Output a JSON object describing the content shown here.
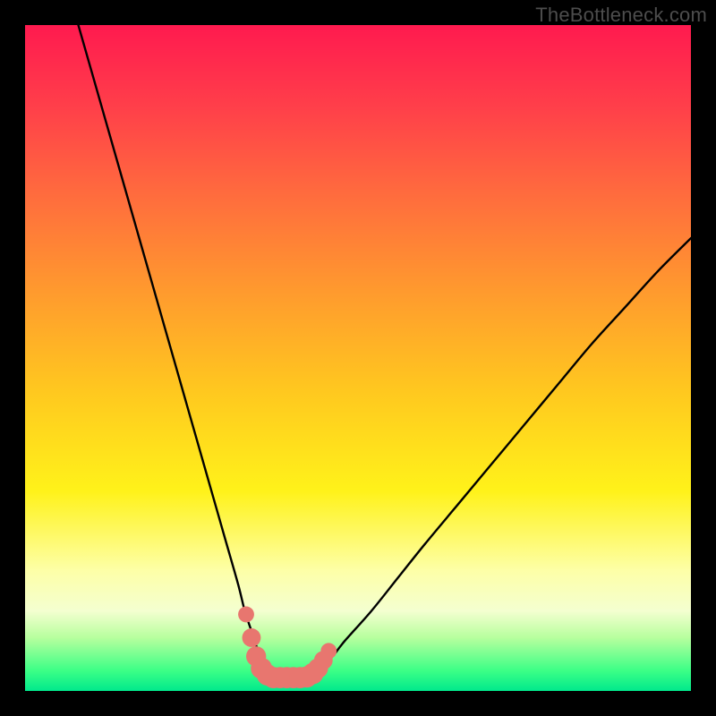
{
  "watermark": "TheBottleneck.com",
  "colors": {
    "frame": "#000000",
    "curve_stroke": "#000000",
    "dot_fill": "#e8766f",
    "gradient_stops": [
      "#ff1a4f",
      "#ff3e4a",
      "#ff6a3e",
      "#ff9a2e",
      "#ffc81f",
      "#fff21a",
      "#fdffa8",
      "#f4ffd0",
      "#b7ff9e",
      "#3bff86",
      "#00e98c"
    ]
  },
  "chart_data": {
    "type": "line",
    "title": "",
    "xlabel": "",
    "ylabel": "",
    "xlim": [
      0,
      100
    ],
    "ylim": [
      0,
      100
    ],
    "series": [
      {
        "name": "bottleneck-curve",
        "x": [
          8,
          10,
          12,
          14,
          16,
          18,
          20,
          22,
          24,
          26,
          28,
          30,
          32,
          33,
          34,
          35,
          36,
          37,
          38,
          39,
          40,
          41,
          42,
          43,
          44,
          46,
          48,
          52,
          56,
          60,
          65,
          70,
          75,
          80,
          85,
          90,
          95,
          100
        ],
        "y": [
          100,
          93,
          86,
          79,
          72,
          65,
          58,
          51,
          44,
          37,
          30,
          23,
          16,
          12,
          9,
          6,
          4,
          3,
          2.2,
          2,
          2,
          2,
          2.2,
          2.6,
          3.4,
          5,
          7.5,
          12,
          17,
          22,
          28,
          34,
          40,
          46,
          52,
          57.5,
          63,
          68
        ]
      }
    ],
    "highlight_points": {
      "name": "bottom-cluster",
      "points": [
        {
          "x": 33.2,
          "y": 11.5,
          "r": 1.2
        },
        {
          "x": 34.0,
          "y": 8.0,
          "r": 1.4
        },
        {
          "x": 34.7,
          "y": 5.2,
          "r": 1.5
        },
        {
          "x": 35.5,
          "y": 3.4,
          "r": 1.6
        },
        {
          "x": 36.4,
          "y": 2.4,
          "r": 1.6
        },
        {
          "x": 37.3,
          "y": 2.0,
          "r": 1.6
        },
        {
          "x": 38.3,
          "y": 2.0,
          "r": 1.6
        },
        {
          "x": 39.3,
          "y": 2.0,
          "r": 1.6
        },
        {
          "x": 40.3,
          "y": 2.0,
          "r": 1.6
        },
        {
          "x": 41.3,
          "y": 2.0,
          "r": 1.6
        },
        {
          "x": 42.3,
          "y": 2.1,
          "r": 1.6
        },
        {
          "x": 43.2,
          "y": 2.6,
          "r": 1.6
        },
        {
          "x": 44.0,
          "y": 3.4,
          "r": 1.5
        },
        {
          "x": 44.8,
          "y": 4.6,
          "r": 1.4
        },
        {
          "x": 45.6,
          "y": 6.0,
          "r": 1.2
        }
      ]
    }
  }
}
